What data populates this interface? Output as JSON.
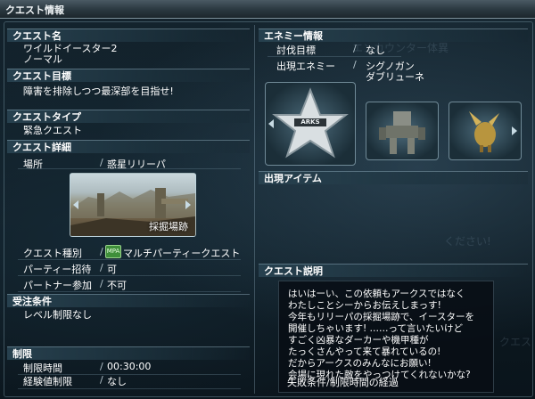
{
  "window": {
    "title": "クエスト情報"
  },
  "quest_name": {
    "header": "クエスト名",
    "line1": "ワイルドイースター2",
    "line2": "ノーマル"
  },
  "quest_goal": {
    "header": "クエスト目標",
    "text": "障害を排除しつつ最深部を目指せ!"
  },
  "quest_type": {
    "header": "クエストタイプ",
    "text": "緊急クエスト"
  },
  "quest_detail": {
    "header": "クエスト詳細",
    "location_label": "場所",
    "location_value": "惑星リリーパ",
    "image_caption": "採掘場跡",
    "kind_label": "クエスト種別",
    "kind_badge": "MPA",
    "kind_value": "マルチパーティークエスト",
    "party_label": "パーティー招待",
    "party_value": "可",
    "partner_label": "パートナー参加",
    "partner_value": "不可"
  },
  "conditions": {
    "header": "受注条件",
    "text": "レベル制限なし"
  },
  "limits": {
    "header": "制限",
    "time_label": "制限時間",
    "time_value": "00:30:00",
    "exp_label": "経験値制限",
    "exp_value": "なし"
  },
  "enemy_info": {
    "header": "エネミー情報",
    "target_label": "討伐目標",
    "target_value": "なし",
    "appear_label": "出現エネミー",
    "appear_line1": "シグノガン",
    "appear_line2": "ダブリューネ",
    "star_badge_text": "ARKS"
  },
  "items": {
    "header": "出現アイテム"
  },
  "description": {
    "header": "クエスト説明",
    "lines": [
      "はいはーい、この依頼もアークスではなく",
      "わたしことシーからお伝えしまっす!",
      "今年もリリーパの採掘場跡で、イースターを",
      "開催しちゃいます! ……って言いたいけど",
      "すごく凶暴なダーカーや機甲種が",
      "たっくさんやって来て暴れているの!",
      "だからアークスのみんなにお願い!",
      "会場に現れた敵をやっつけてくれないかな?"
    ],
    "fail_condition": "失敗条件/制限時間の経過"
  },
  "background_text": {
    "a": "エンカウンター体異",
    "b": "ください!",
    "c": "クエスト"
  }
}
